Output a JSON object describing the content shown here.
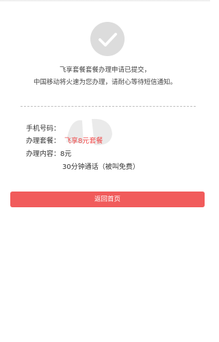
{
  "status": {
    "icon": "check-icon",
    "line1": "飞享套餐套餐办理申请已提交，",
    "line2": "中国移动将火速为您办理，请耐心等待短信通知。"
  },
  "details": {
    "phone_label": "手机号码：",
    "phone_value": "",
    "package_label": "办理套餐：",
    "package_value": "飞享8元套餐",
    "content_label": "办理内容：",
    "content_value": "8元",
    "content_extra": "30分钟通话（被叫免费）"
  },
  "button": {
    "label": "返回首页"
  },
  "colors": {
    "accent": "#f15b5b",
    "highlight_text": "#ef4a4a",
    "check_circle": "#dcdcdc"
  }
}
